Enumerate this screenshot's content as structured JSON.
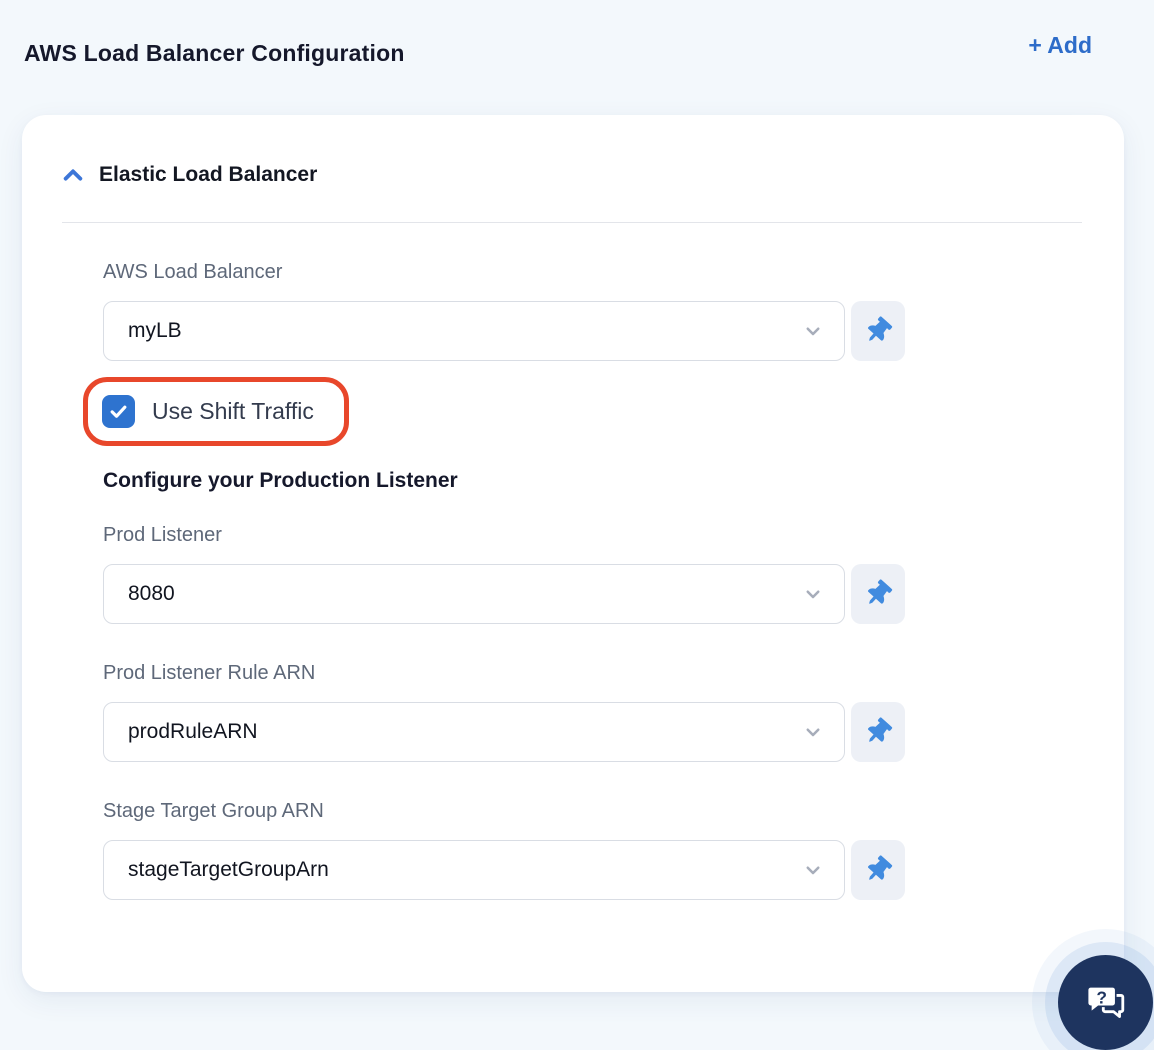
{
  "header": {
    "title": "AWS Load Balancer Configuration",
    "add_button_label": "+ Add"
  },
  "panel": {
    "section_title": "Elastic Load Balancer",
    "collapsed": false
  },
  "form": {
    "fields": [
      {
        "label": "AWS Load Balancer",
        "value": "myLB"
      },
      {
        "label": "Prod Listener",
        "value": "8080"
      },
      {
        "label": "Prod Listener Rule ARN",
        "value": "prodRuleARN"
      },
      {
        "label": "Stage Target Group ARN",
        "value": "stageTargetGroupArn"
      }
    ],
    "shift_traffic_checkbox": {
      "label": "Use Shift Traffic",
      "checked": true
    },
    "subheading": "Configure your Production Listener"
  },
  "annotation": {
    "type": "highlight-ring",
    "target": "shift-traffic-checkbox",
    "color": "#e8472b"
  },
  "icons": {
    "collapse": "chevron-up-icon",
    "dropdown": "chevron-down-icon",
    "pin": "pushpin-icon",
    "check": "checkmark-icon",
    "help": "chat-question-icon"
  },
  "colors": {
    "page_bg": "#f3f8fc",
    "accent_blue": "#2d6cc9",
    "checkbox_blue": "#2e73cf",
    "pin_blue": "#418bdf",
    "annotation_red": "#e8472b",
    "help_button_navy": "#1e345f"
  }
}
